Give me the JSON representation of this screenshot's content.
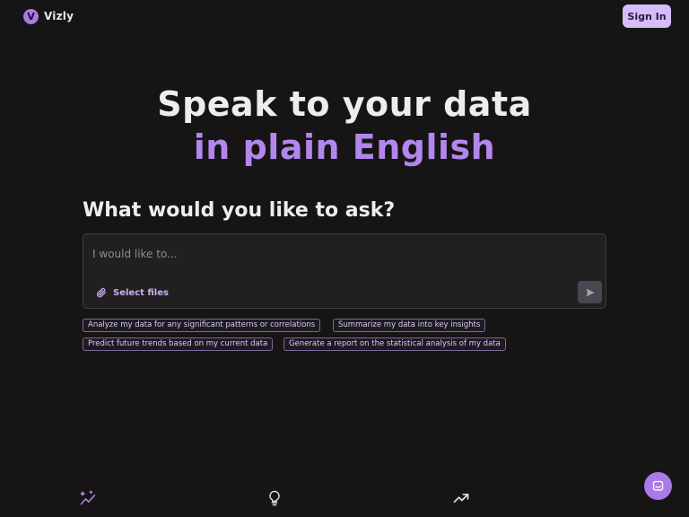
{
  "header": {
    "logo_letter": "V",
    "brand_name": "Vizly",
    "signin_label": "Sign In"
  },
  "hero": {
    "line1": "Speak to your data",
    "line2": "in plain English"
  },
  "ask": {
    "heading": "What would you like to ask?",
    "placeholder": "I would like to...",
    "value": "",
    "select_files_label": "Select files"
  },
  "suggestions": [
    "Analyze my data for any significant patterns or correlations",
    "Summarize my data into key insights",
    "Predict future trends based on my current data",
    "Generate a report on the statistical analysis of my data"
  ],
  "icons": {
    "attach": "paperclip-icon",
    "send": "send-icon",
    "feature1": "sparkle-chart-icon",
    "feature2": "lightbulb-icon",
    "feature3": "trending-up-icon",
    "chat": "chat-icon"
  },
  "colors": {
    "background": "#161415",
    "accent": "#b286ec",
    "button": "#d6bdf9"
  }
}
